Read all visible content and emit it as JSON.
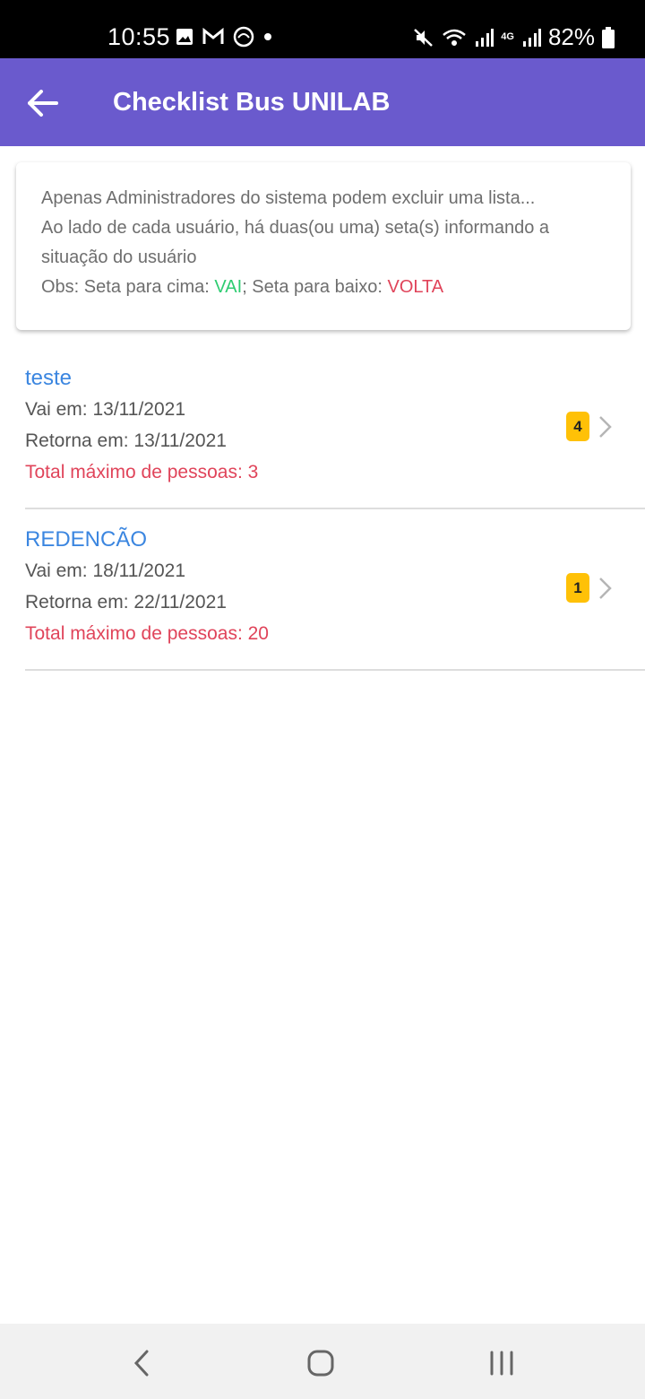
{
  "status_bar": {
    "time": "10:55",
    "battery": "82%",
    "network": "4G"
  },
  "app_bar": {
    "title": "Checklist Bus UNILAB"
  },
  "info_card": {
    "line1": "Apenas Administradores do sistema podem excluir uma lista...",
    "line2": "Ao lado de cada usuário, há duas(ou uma) seta(s) informando a situação do usuário",
    "obs_prefix": "Obs: Seta para cima: ",
    "vai": "VAI",
    "middle": "; Seta para baixo: ",
    "volta": "VOLTA"
  },
  "trips": [
    {
      "title": "teste",
      "vai": "Vai em: 13/11/2021",
      "retorna": "Retorna em: 13/11/2021",
      "total": "Total máximo de pessoas: 3",
      "badge": "4"
    },
    {
      "title": "REDENCÃO",
      "vai": "Vai em: 18/11/2021",
      "retorna": "Retorna em: 22/11/2021",
      "total": "Total máximo de pessoas: 20",
      "badge": "1"
    }
  ],
  "colors": {
    "app_bar": "#6a5acd",
    "title_link": "#3b86e0",
    "vai_green": "#2ecc71",
    "red": "#e0445a",
    "badge": "#ffc107"
  }
}
